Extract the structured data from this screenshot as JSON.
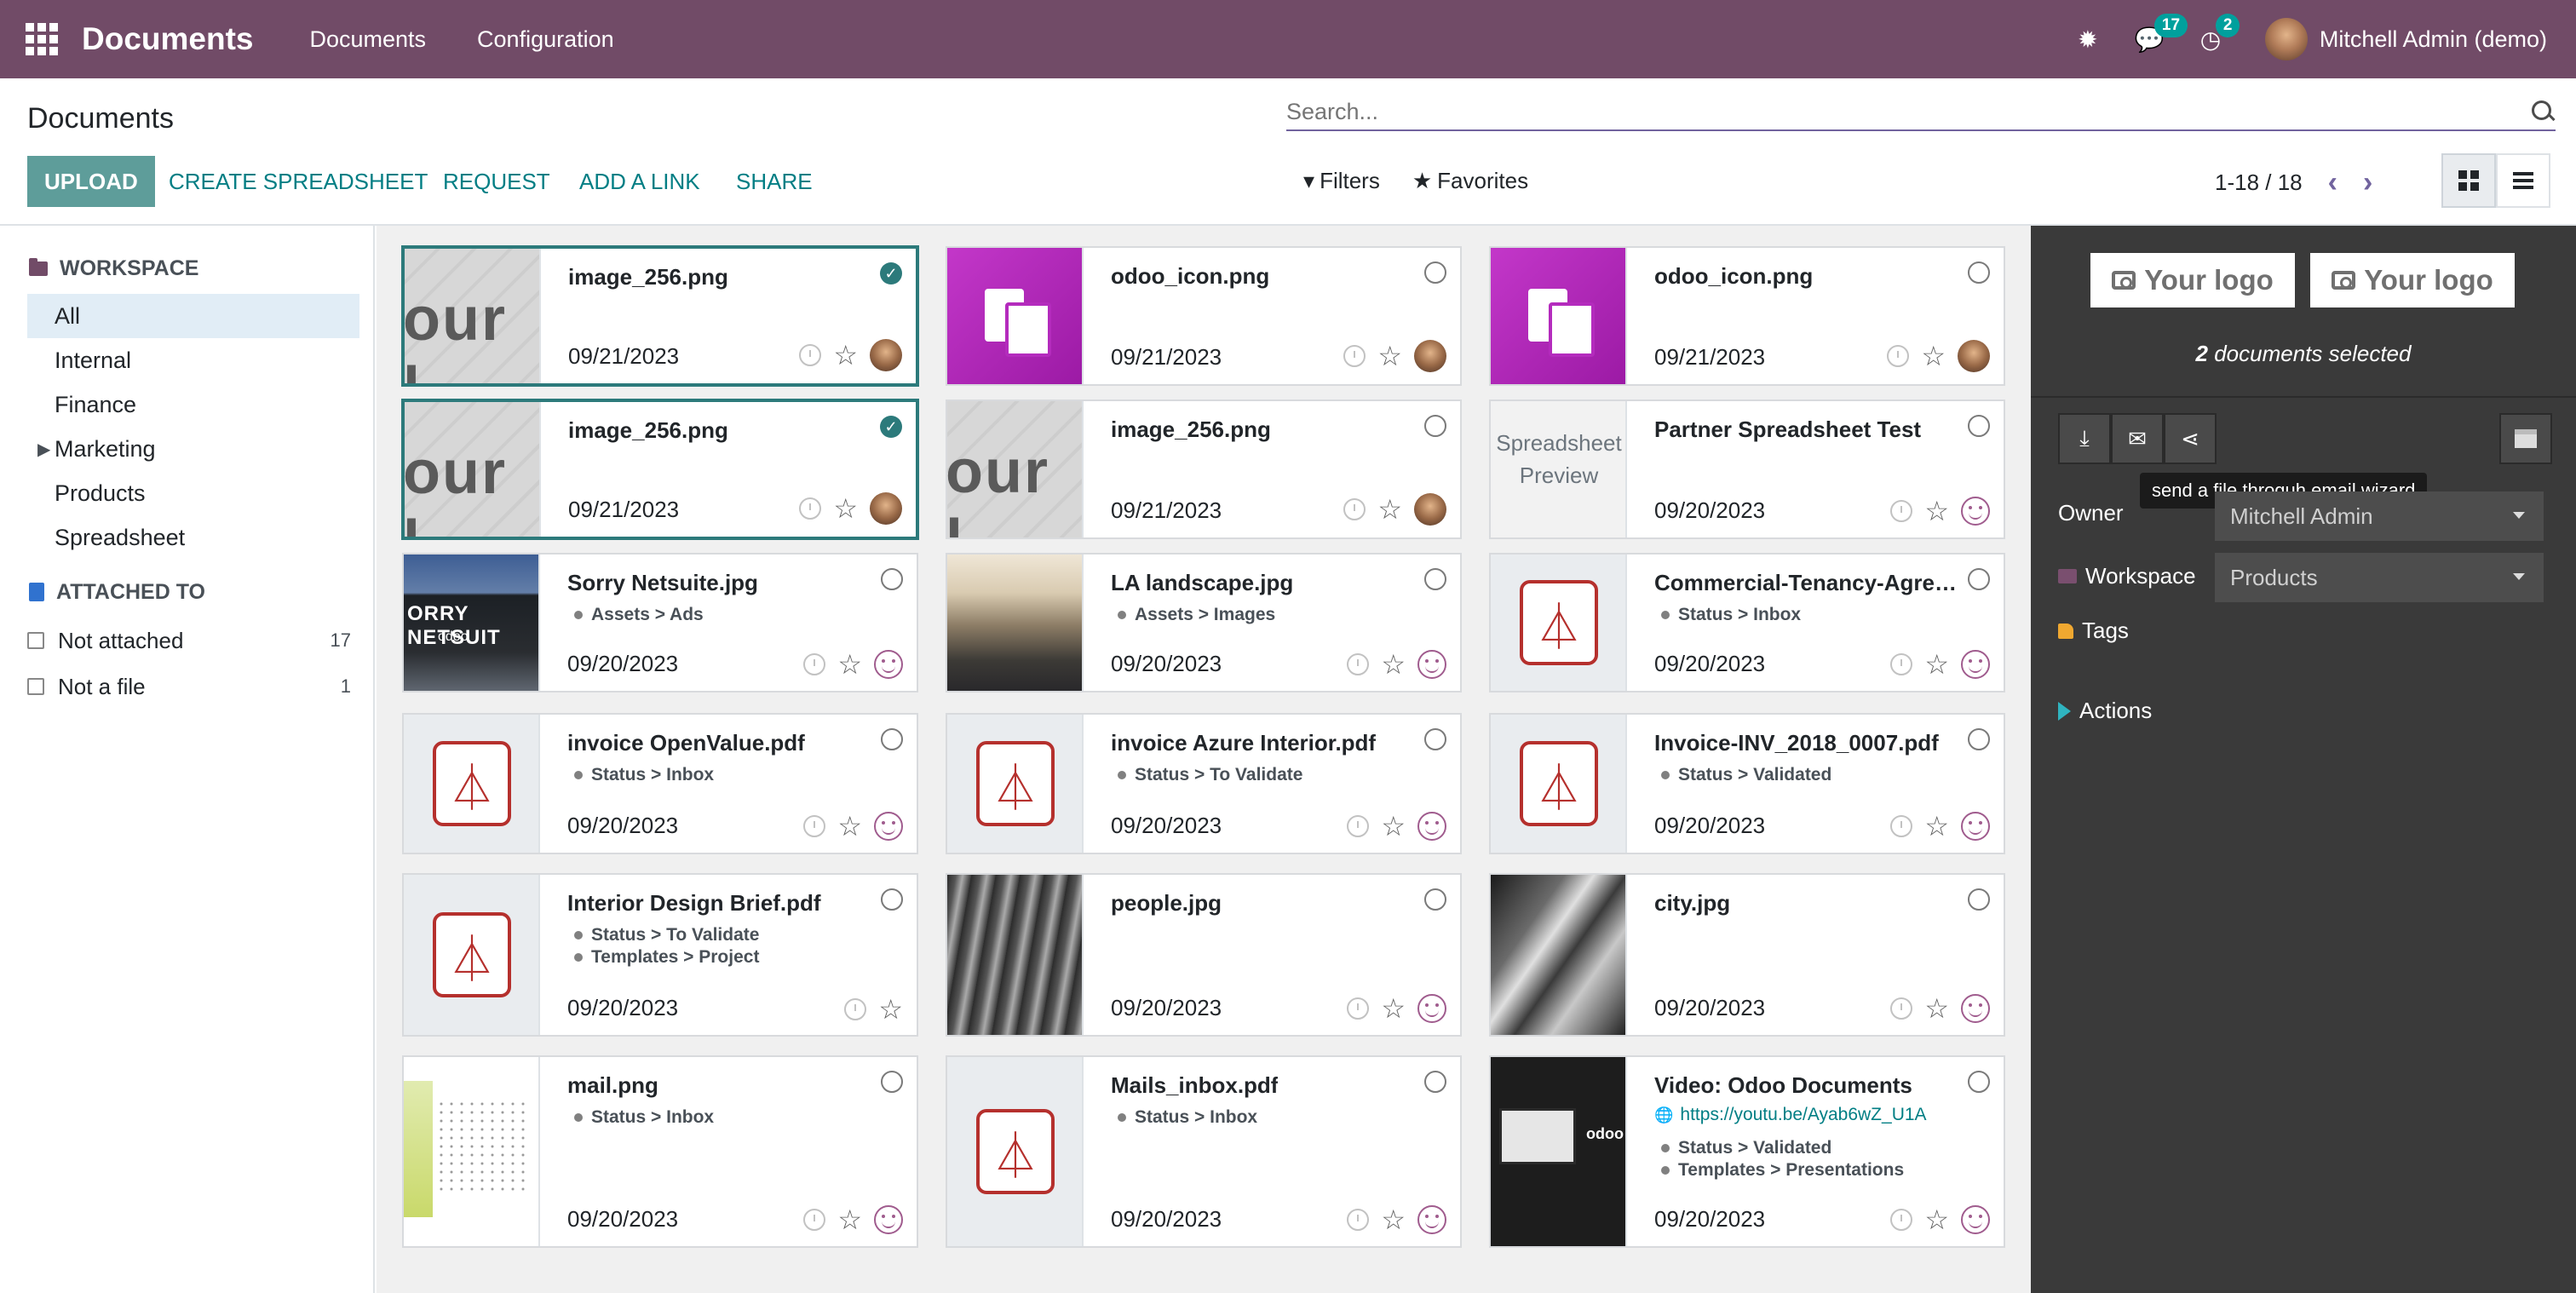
{
  "navbar": {
    "app_name": "Documents",
    "menus": [
      "Documents",
      "Configuration"
    ],
    "messages_count": "17",
    "activities_count": "2",
    "user_name": "Mitchell Admin (demo)"
  },
  "control_panel": {
    "title": "Documents",
    "search_placeholder": "Search...",
    "buttons": {
      "upload": "UPLOAD",
      "create_spreadsheet": "CREATE SPREADSHEET",
      "request": "REQUEST",
      "add_link": "ADD A LINK",
      "share": "SHARE"
    },
    "filters": "Filters",
    "favorites": "Favorites",
    "pager": "1-18 / 18"
  },
  "sidebar": {
    "workspace_title": "WORKSPACE",
    "workspaces": [
      {
        "label": "All",
        "active": true
      },
      {
        "label": "Internal"
      },
      {
        "label": "Finance"
      },
      {
        "label": "Marketing",
        "expandable": true
      },
      {
        "label": "Products"
      },
      {
        "label": "Spreadsheet"
      }
    ],
    "attached_title": "ATTACHED TO",
    "attached": [
      {
        "label": "Not attached",
        "count": "17"
      },
      {
        "label": "Not a file",
        "count": "1"
      }
    ]
  },
  "documents": [
    {
      "name": "image_256.png",
      "date": "09/21/2023",
      "tags": [],
      "selected": true,
      "thumb": "img256",
      "owner": "avatar"
    },
    {
      "name": "odoo_icon.png",
      "date": "09/21/2023",
      "tags": [],
      "selected": false,
      "thumb": "odoo",
      "owner": "avatar"
    },
    {
      "name": "odoo_icon.png",
      "date": "09/21/2023",
      "tags": [],
      "selected": false,
      "thumb": "odoo",
      "owner": "avatar"
    },
    {
      "name": "image_256.png",
      "date": "09/21/2023",
      "tags": [],
      "selected": true,
      "thumb": "img256",
      "owner": "avatar"
    },
    {
      "name": "image_256.png",
      "date": "09/21/2023",
      "tags": [],
      "selected": false,
      "thumb": "img256",
      "owner": "avatar"
    },
    {
      "name": "Partner Spreadsheet Test",
      "date": "09/20/2023",
      "tags": [],
      "selected": false,
      "thumb": "spreadsheet",
      "thumb_text": "Spreadsheet Preview",
      "owner": "smiley"
    },
    {
      "name": "Sorry Netsuite.jpg",
      "date": "09/20/2023",
      "tags": [
        "Assets > Ads"
      ],
      "selected": false,
      "thumb": "photo-bill",
      "owner": "smiley"
    },
    {
      "name": "LA landscape.jpg",
      "date": "09/20/2023",
      "tags": [
        "Assets > Images"
      ],
      "selected": false,
      "thumb": "photo-la",
      "owner": "smiley"
    },
    {
      "name": "Commercial-Tenancy-Agree...",
      "date": "09/20/2023",
      "tags": [
        "Status > Inbox"
      ],
      "selected": false,
      "thumb": "pdf",
      "owner": "smiley"
    },
    {
      "name": "invoice OpenValue.pdf",
      "date": "09/20/2023",
      "tags": [
        "Status > Inbox"
      ],
      "selected": false,
      "thumb": "pdf",
      "owner": "smiley"
    },
    {
      "name": "invoice Azure Interior.pdf",
      "date": "09/20/2023",
      "tags": [
        "Status > To Validate"
      ],
      "selected": false,
      "thumb": "pdf",
      "owner": "smiley"
    },
    {
      "name": "Invoice-INV_2018_0007.pdf",
      "date": "09/20/2023",
      "tags": [
        "Status > Validated"
      ],
      "selected": false,
      "thumb": "pdf",
      "owner": "smiley"
    },
    {
      "name": "Interior Design Brief.pdf",
      "date": "09/20/2023",
      "tags": [
        "Status > To Validate",
        "Templates > Project"
      ],
      "selected": false,
      "thumb": "pdf",
      "owner": "none"
    },
    {
      "name": "people.jpg",
      "date": "09/20/2023",
      "tags": [],
      "selected": false,
      "thumb": "photo-people",
      "owner": "smiley"
    },
    {
      "name": "city.jpg",
      "date": "09/20/2023",
      "tags": [],
      "selected": false,
      "thumb": "photo-city",
      "owner": "smiley"
    },
    {
      "name": "mail.png",
      "date": "09/20/2023",
      "tags": [
        "Status > Inbox"
      ],
      "selected": false,
      "thumb": "mail",
      "owner": "smiley"
    },
    {
      "name": "Mails_inbox.pdf",
      "date": "09/20/2023",
      "tags": [
        "Status > Inbox"
      ],
      "selected": false,
      "thumb": "pdf",
      "owner": "smiley"
    },
    {
      "name": "Video: Odoo Documents",
      "date": "09/20/2023",
      "link": "https://youtu.be/Ayab6wZ_U1A",
      "tags": [
        "Status > Validated",
        "Templates > Presentations"
      ],
      "selected": false,
      "thumb": "video",
      "owner": "smiley"
    }
  ],
  "inspector": {
    "logo_text": "Your logo",
    "selected_count": "2",
    "selected_suffix": "documents selected",
    "tooltip": "send a file throguh email wizard",
    "owner_label": "Owner",
    "owner_value": "Mitchell Admin",
    "workspace_label": "Workspace",
    "workspace_value": "Products",
    "tags_label": "Tags",
    "actions_label": "Actions"
  },
  "colors": {
    "brand": "#714b67",
    "accent": "#017e84",
    "selected_border": "#2c7a7b",
    "inspector_bg": "#3a3a3a"
  }
}
